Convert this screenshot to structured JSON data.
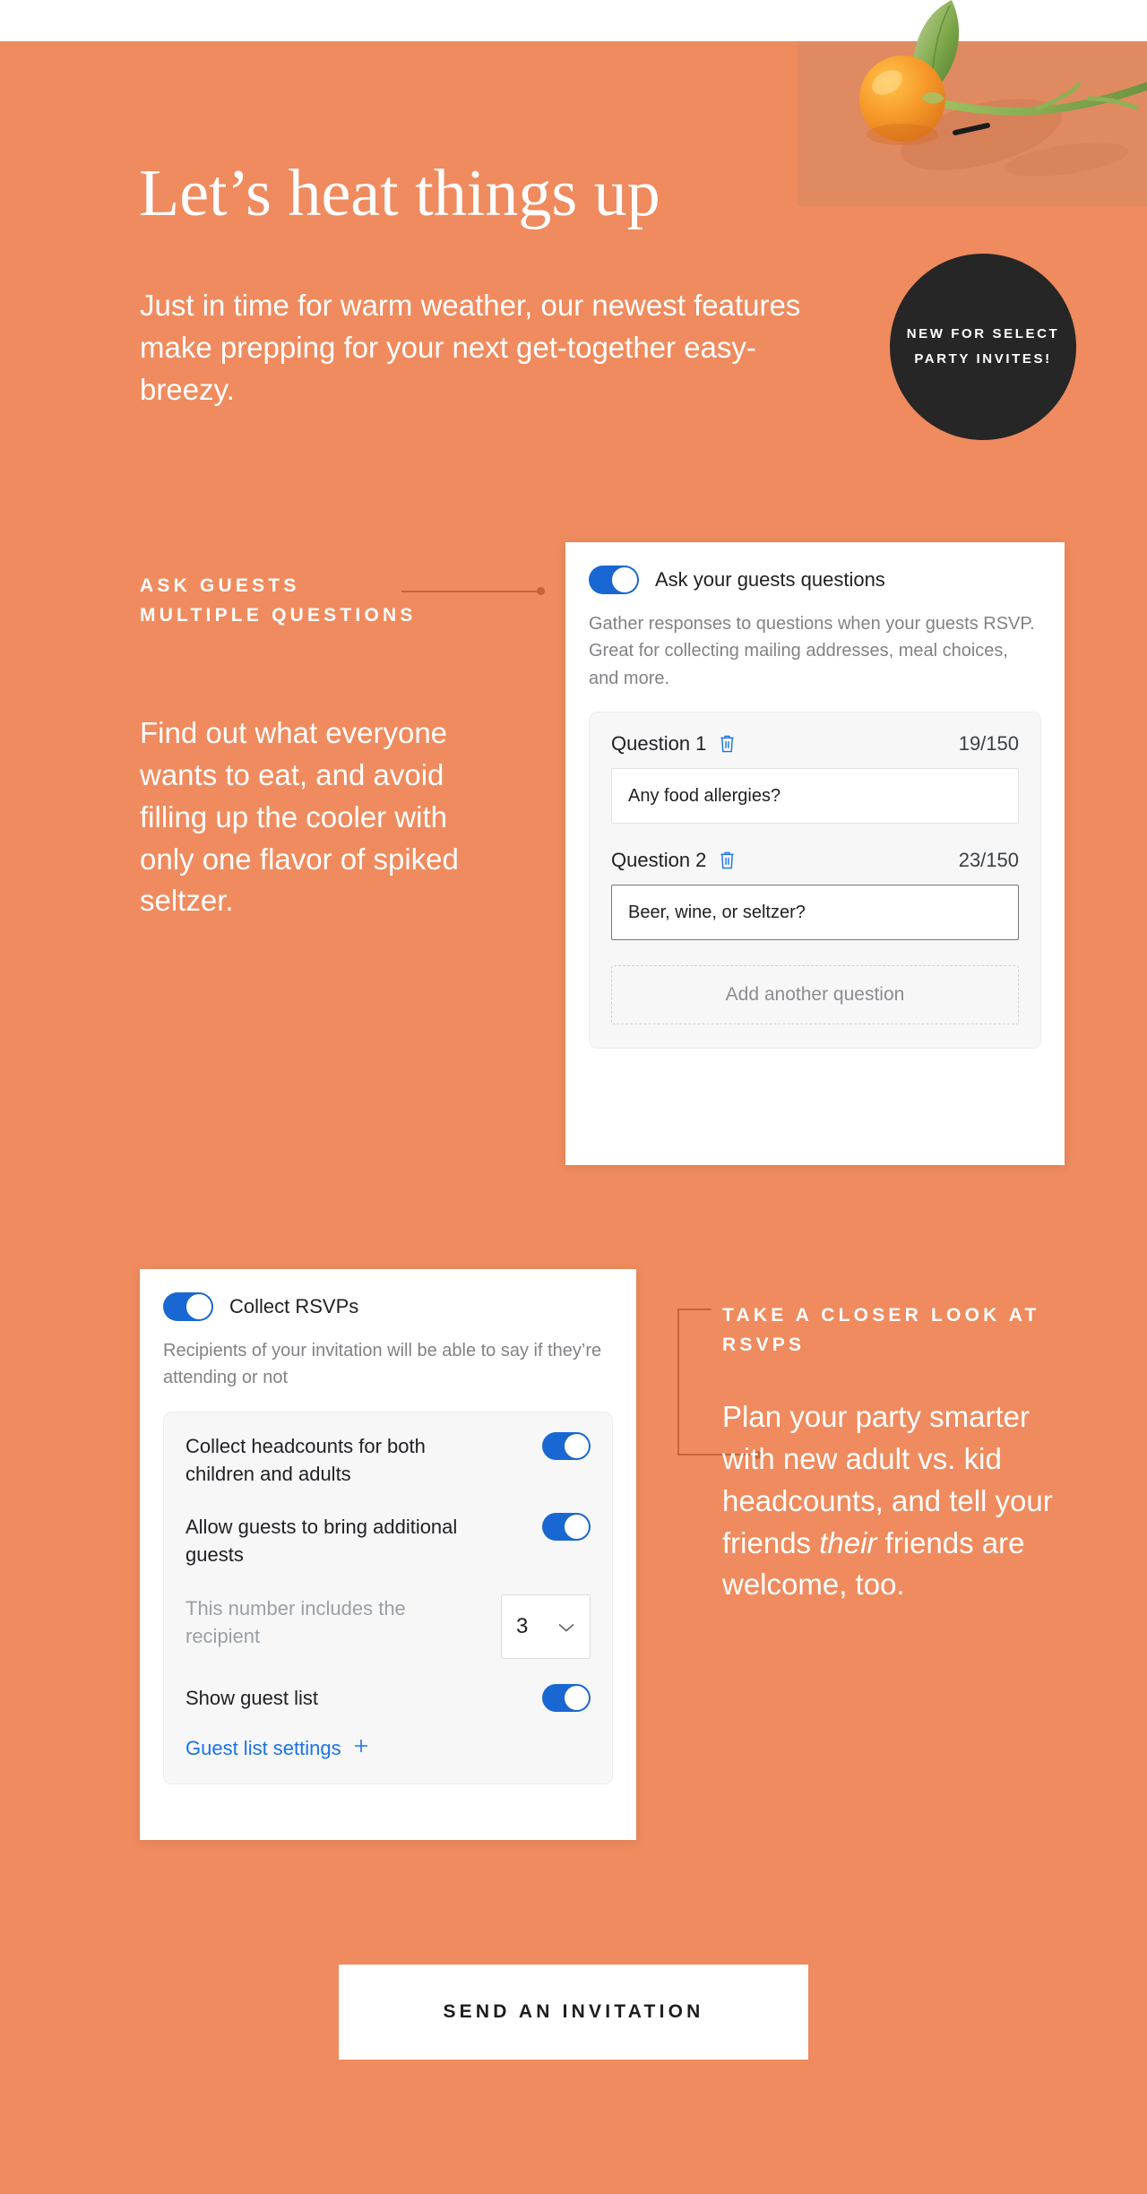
{
  "theme": {
    "background": "#ef8b5e",
    "accent_line": "#c4643c",
    "badge_background": "#262626",
    "toggle_on": "#1967d2",
    "link_blue": "#1a73e8",
    "cta_background": "#ffffff",
    "cta_text": "#1d1d1d"
  },
  "hero": {
    "headline": "Let’s heat things up",
    "subheadline": "Just in time for warm weather, our newest features make prepping for your next get-together easy-breezy.",
    "badge": "NEW FOR SELECT PARTY INVITES!",
    "photo_alt": "kumquat-branch-photo"
  },
  "section_questions": {
    "eyebrow": "ASK GUESTS MULTIPLE QUESTIONS",
    "body": "Find out what everyone wants to eat, and avoid filling up the cooler with only one flavor of spiked seltzer.",
    "card": {
      "toggle_label": "Ask your guests questions",
      "toggle_on": true,
      "description": "Gather responses to questions when your guests RSVP. Great for collecting mailing addresses, meal choices, and more.",
      "questions": [
        {
          "label": "Question 1",
          "counter": "19/150",
          "value": "Any food allergies?",
          "focused": false,
          "delete_icon": "trash-icon"
        },
        {
          "label": "Question 2",
          "counter": "23/150",
          "value": "Beer, wine, or seltzer?",
          "focused": true,
          "delete_icon": "trash-icon"
        }
      ],
      "add_label": "Add another question"
    }
  },
  "section_rsvp": {
    "eyebrow": "TAKE A CLOSER LOOK AT RSVPS",
    "body_before_em": "Plan your party smarter with new adult vs. kid headcounts, and tell your friends ",
    "body_em": "their",
    "body_after_em": " friends are welcome, too.",
    "card": {
      "toggle_label": "Collect RSVPs",
      "toggle_on": true,
      "description": "Recipients of your invitation will be able to say if they’re attending or not",
      "rows": [
        {
          "label": "Collect headcounts for both children and adults",
          "control": "toggle",
          "on": true,
          "muted": false
        },
        {
          "label": "Allow guests to bring additional guests",
          "control": "toggle",
          "on": true,
          "muted": false
        },
        {
          "label": "This number includes the recipient",
          "control": "select",
          "value": "3",
          "muted": true
        },
        {
          "label": "Show guest list",
          "control": "toggle",
          "on": true,
          "muted": false
        }
      ],
      "guest_link": "Guest list settings",
      "guest_link_icon": "plus-icon"
    }
  },
  "cta": {
    "label": "SEND AN INVITATION"
  }
}
